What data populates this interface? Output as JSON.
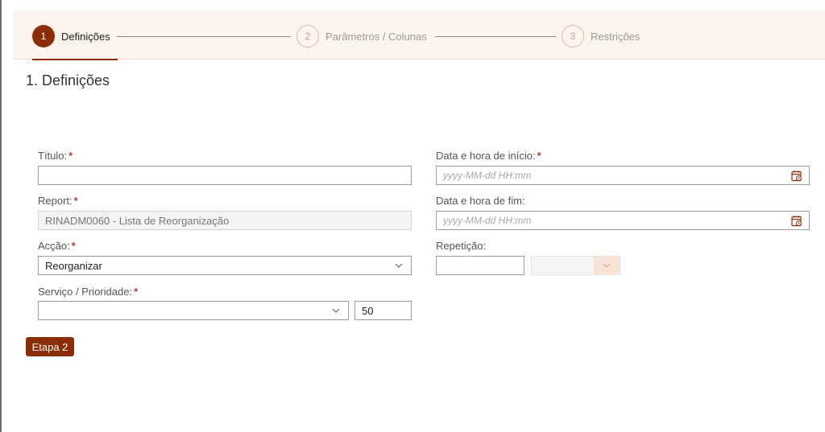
{
  "stepper": {
    "steps": [
      {
        "number": "1",
        "label": "Definições"
      },
      {
        "number": "2",
        "label": "Parâmetros / Colunas"
      },
      {
        "number": "3",
        "label": "Restrições"
      }
    ]
  },
  "section_title": "1. Definições",
  "form": {
    "titulo": {
      "label": "Título:",
      "required": "*",
      "value": ""
    },
    "report": {
      "label": "Report:",
      "required": "*",
      "value": "RINADM0060 - Lista de Reorganização"
    },
    "accao": {
      "label": "Acção:",
      "required": "*",
      "value": "Reorganizar"
    },
    "servico": {
      "label": "Serviço / Prioridade:",
      "required": "*",
      "value": "",
      "priority": "50"
    },
    "inicio": {
      "label": "Data e hora de início:",
      "required": "*",
      "placeholder": "yyyy-MM-dd HH:mm"
    },
    "fim": {
      "label": "Data e hora de fim:",
      "placeholder": "yyyy-MM-dd HH:mm"
    },
    "repeticao": {
      "label": "Repetição:",
      "value": ""
    }
  },
  "buttons": {
    "next": "Etapa 2"
  },
  "icons": {
    "dropdown": "chevron-down-icon",
    "calendar": "calendar-clock-icon"
  },
  "colors": {
    "accent": "#8b2d06",
    "stepper_bg": "#fdf4ee",
    "required": "#c0392b"
  }
}
